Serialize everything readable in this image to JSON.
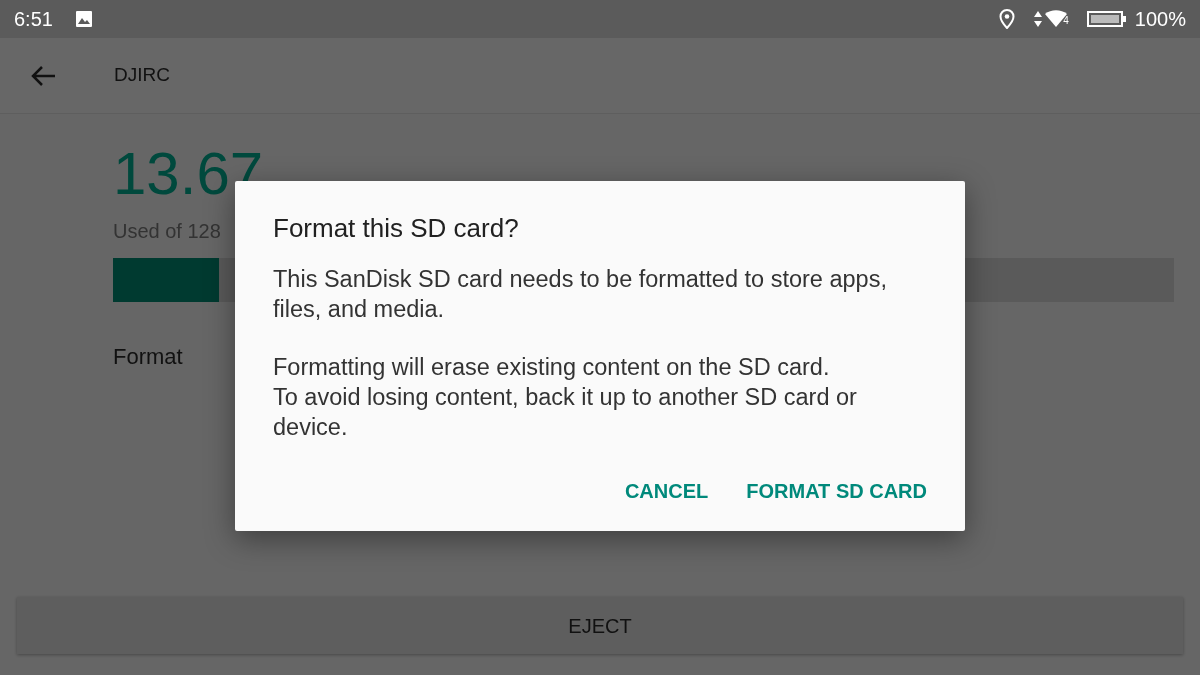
{
  "status_bar": {
    "time": "6:51",
    "network_badge": "4",
    "battery_text": "100%"
  },
  "app_bar": {
    "title": "DJIRC"
  },
  "storage": {
    "used_amount": "13.67",
    "caption": "Used of 128",
    "level": 0.1
  },
  "settings_items": [
    {
      "label": "Format"
    }
  ],
  "eject_button": {
    "label": "EJECT"
  },
  "dialog": {
    "title": "Format this SD card?",
    "paragraphs": [
      "This SanDisk SD card needs to be formatted to store apps, files, and media.",
      "Formatting will erase existing content on the SD card.\nTo avoid losing content, back it up to another SD card or device."
    ],
    "buttons": [
      {
        "label": "CANCEL"
      },
      {
        "label": "FORMAT SD CARD"
      }
    ]
  }
}
